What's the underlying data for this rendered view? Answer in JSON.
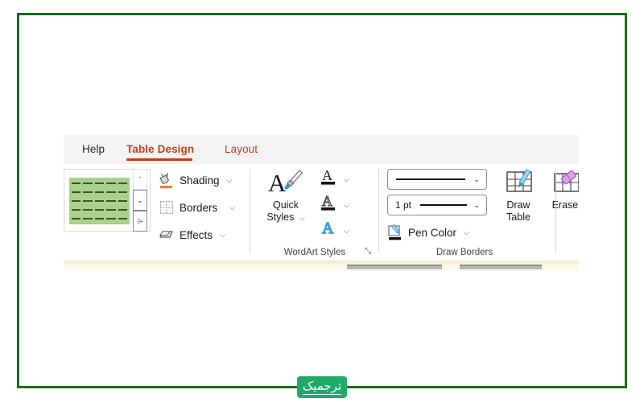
{
  "frame": {
    "border_color": "#1d6b1d"
  },
  "ribbon": {
    "tabs": [
      {
        "name": "help",
        "label": "Help",
        "active": false,
        "color": "#262626"
      },
      {
        "name": "design",
        "label": "Table Design",
        "active": true,
        "color": "#c43e1c"
      },
      {
        "name": "layout",
        "label": "Layout",
        "active": false,
        "color": "#c43e1c"
      }
    ],
    "groups": [
      {
        "name": "table-styles",
        "label": "",
        "gallery": {
          "thumbnail_fill": "#a9d18e",
          "thumbnail_line": "#375623",
          "columns": 5,
          "rows": 5,
          "scroll_up": "⌃",
          "scroll_down": "⌄",
          "scroll_more": "⩥"
        }
      },
      {
        "name": "shading-borders-effects",
        "label": "",
        "items": [
          {
            "label": "Shading",
            "icon": "paint-bucket-icon",
            "has_caret": true,
            "accent": "#ed7d31"
          },
          {
            "label": "Borders",
            "icon": "borders-grid-icon",
            "has_caret": true,
            "accent": "#7f7f7f"
          },
          {
            "label": "Effects",
            "icon": "effects-cube-icon",
            "has_caret": true,
            "accent": "#595959"
          }
        ]
      },
      {
        "name": "wordart-styles",
        "label": "WordArt Styles",
        "quick_styles": {
          "label_line1": "Quick",
          "label_line2": "Styles",
          "icon": "a-paintbrush-icon",
          "has_caret": true
        },
        "buttons": [
          {
            "name": "text-fill",
            "glyph": "A",
            "icon": "text-fill-icon",
            "color": "#1a1a1a",
            "bar_color": "#111111",
            "outlined": false,
            "has_caret": true
          },
          {
            "name": "text-outline",
            "glyph": "A",
            "icon": "text-outline-icon",
            "color": "#3f3f3f",
            "bar_color": "#111111",
            "outlined": true,
            "has_caret": true
          },
          {
            "name": "text-effects",
            "glyph": "A",
            "icon": "text-effects-icon",
            "color": "#2e9bd6",
            "bar_color": "",
            "outlined": true,
            "has_caret": true
          }
        ],
        "dialog_launcher": "⤡"
      },
      {
        "name": "draw-borders",
        "label": "Draw Borders",
        "pen_style": {
          "name": "pen-style-combo",
          "value": "",
          "caret": "⌄"
        },
        "pen_weight": {
          "name": "pen-weight-combo",
          "value": "1 pt",
          "caret": "⌄"
        },
        "pen_color": {
          "name": "pen-color-button",
          "label": "Pen Color",
          "icon": "pen-color-icon",
          "has_caret": true,
          "accent": "#2e9bd6"
        },
        "big_buttons": [
          {
            "name": "draw-table-button",
            "line1": "Draw",
            "line2": "Table",
            "icon": "draw-table-icon",
            "accent": "#2e9bd6"
          },
          {
            "name": "eraser-button",
            "line1": "Eraser",
            "line2": "",
            "icon": "eraser-icon",
            "accent": "#b05cc6"
          }
        ]
      }
    ]
  },
  "logo": {
    "text": "ترجمیک",
    "background": "#1faa6b",
    "text_color": "#ffffff"
  }
}
